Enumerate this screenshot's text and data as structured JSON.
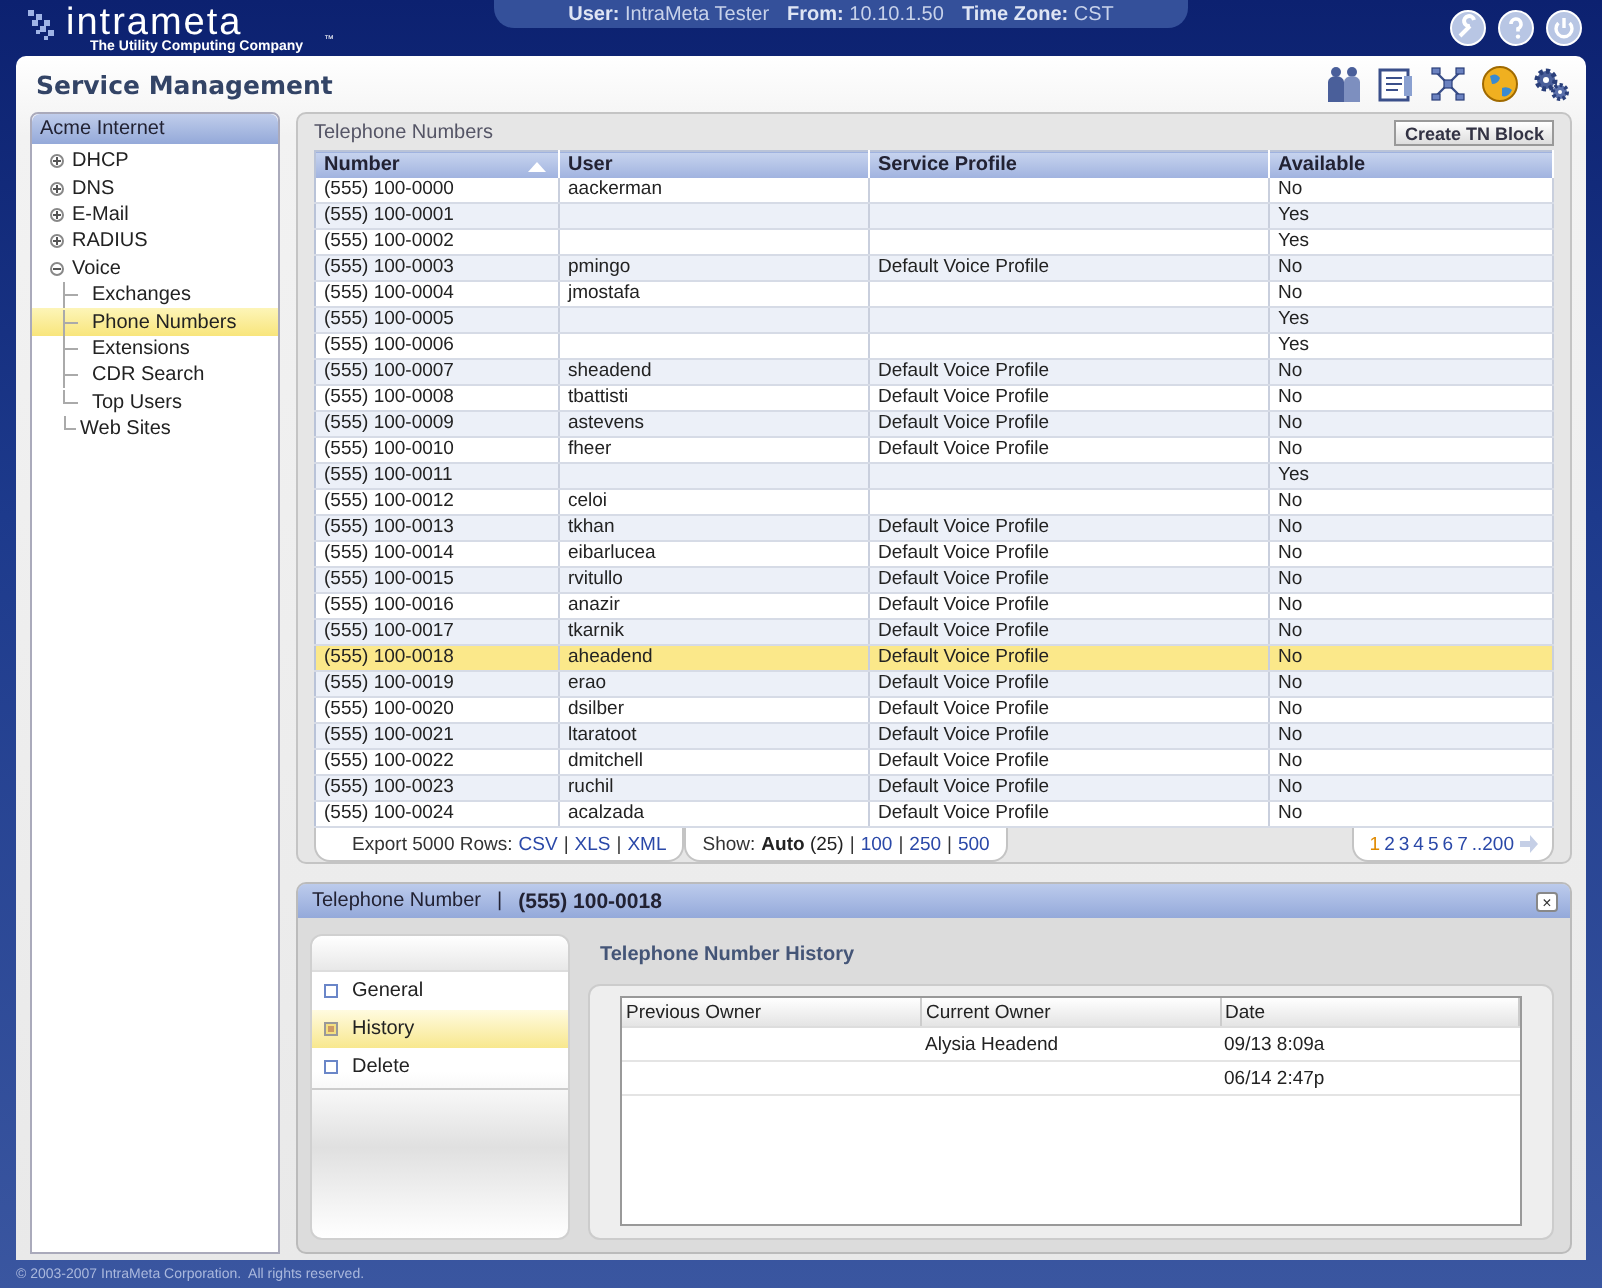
{
  "header": {
    "logo": "intrameta",
    "tagline": "The Utility Computing Company",
    "trademark": "™",
    "user_label": "User:",
    "user": "IntraMeta Tester",
    "from_label": "From:",
    "from": "10.10.1.50",
    "tz_label": "Time Zone:",
    "tz": "CST"
  },
  "page_title": "Service Management",
  "sidebar": {
    "title": "Acme Internet",
    "items": [
      {
        "label": "DHCP",
        "expanded": false,
        "selected": false
      },
      {
        "label": "DNS",
        "expanded": false,
        "selected": false
      },
      {
        "label": "E-Mail",
        "expanded": false,
        "selected": false
      },
      {
        "label": "RADIUS",
        "expanded": false,
        "selected": false
      },
      {
        "label": "Voice",
        "expanded": true,
        "selected": false,
        "children": [
          {
            "label": "Exchanges",
            "selected": false
          },
          {
            "label": "Phone Numbers",
            "selected": true
          },
          {
            "label": "Extensions",
            "selected": false
          },
          {
            "label": "CDR Search",
            "selected": false
          },
          {
            "label": "Top Users",
            "selected": false
          }
        ]
      },
      {
        "label": "Web Sites",
        "selected": false
      }
    ]
  },
  "table_panel": {
    "title": "Telephone Numbers",
    "create_button": "Create TN Block",
    "columns": [
      {
        "label": "Number",
        "sorted": true
      },
      {
        "label": "User",
        "sorted": false
      },
      {
        "label": "Service Profile",
        "sorted": false
      },
      {
        "label": "Available",
        "sorted": false
      }
    ],
    "rows": [
      {
        "number": "(555) 100-0000",
        "user": "aackerman",
        "available": "No",
        "selected": false
      },
      {
        "number": "(555) 100-0001",
        "available": "Yes",
        "selected": false
      },
      {
        "number": "(555) 100-0002",
        "available": "Yes",
        "selected": false
      },
      {
        "number": "(555) 100-0003",
        "user": "pmingo",
        "profile": "Default Voice Profile",
        "available": "No",
        "selected": false
      },
      {
        "number": "(555) 100-0004",
        "user": "jmostafa",
        "available": "No",
        "selected": false
      },
      {
        "number": "(555) 100-0005",
        "available": "Yes",
        "selected": false
      },
      {
        "number": "(555) 100-0006",
        "available": "Yes",
        "selected": false
      },
      {
        "number": "(555) 100-0007",
        "user": "sheadend",
        "profile": "Default Voice Profile",
        "available": "No",
        "selected": false
      },
      {
        "number": "(555) 100-0008",
        "user": "tbattisti",
        "profile": "Default Voice Profile",
        "available": "No",
        "selected": false
      },
      {
        "number": "(555) 100-0009",
        "user": "astevens",
        "profile": "Default Voice Profile",
        "available": "No",
        "selected": false
      },
      {
        "number": "(555) 100-0010",
        "user": "fheer",
        "profile": "Default Voice Profile",
        "available": "No",
        "selected": false
      },
      {
        "number": "(555) 100-0011",
        "available": "Yes",
        "selected": false
      },
      {
        "number": "(555) 100-0012",
        "user": "celoi",
        "available": "No",
        "selected": false
      },
      {
        "number": "(555) 100-0013",
        "user": "tkhan",
        "profile": "Default Voice Profile",
        "available": "No",
        "selected": false
      },
      {
        "number": "(555) 100-0014",
        "user": "eibarlucea",
        "profile": "Default Voice Profile",
        "available": "No",
        "selected": false
      },
      {
        "number": "(555) 100-0015",
        "user": "rvitullo",
        "profile": "Default Voice Profile",
        "available": "No",
        "selected": false
      },
      {
        "number": "(555) 100-0016",
        "user": "anazir",
        "profile": "Default Voice Profile",
        "available": "No",
        "selected": false
      },
      {
        "number": "(555) 100-0017",
        "user": "tkarnik",
        "profile": "Default Voice Profile",
        "available": "No",
        "selected": false
      },
      {
        "number": "(555) 100-0018",
        "user": "aheadend",
        "profile": "Default Voice Profile",
        "available": "No",
        "selected": true
      },
      {
        "number": "(555) 100-0019",
        "user": "erao",
        "profile": "Default Voice Profile",
        "available": "No",
        "selected": false
      },
      {
        "number": "(555) 100-0020",
        "user": "dsilber",
        "profile": "Default Voice Profile",
        "available": "No",
        "selected": false
      },
      {
        "number": "(555) 100-0021",
        "user": "ltaratoot",
        "profile": "Default Voice Profile",
        "available": "No",
        "selected": false
      },
      {
        "number": "(555) 100-0022",
        "user": "dmitchell",
        "profile": "Default Voice Profile",
        "available": "No",
        "selected": false
      },
      {
        "number": "(555) 100-0023",
        "user": "ruchil",
        "profile": "Default Voice Profile",
        "available": "No",
        "selected": false
      },
      {
        "number": "(555) 100-0024",
        "user": "acalzada",
        "profile": "Default Voice Profile",
        "available": "No",
        "selected": false
      }
    ],
    "link_separator": "|",
    "export_label": "Export 5000 Rows:",
    "export_links": [
      "CSV",
      "XLS",
      "XML"
    ],
    "show_label": "Show:",
    "show_options": [
      {
        "label": "Auto",
        "count": "(25)",
        "selected": true
      },
      {
        "label": "100",
        "selected": false
      },
      {
        "label": "250",
        "selected": false
      },
      {
        "label": "500",
        "selected": false
      }
    ],
    "pages": [
      {
        "label": "1",
        "selected": true
      },
      {
        "label": "2",
        "selected": false
      },
      {
        "label": "3",
        "selected": false
      },
      {
        "label": "4",
        "selected": false
      },
      {
        "label": "5",
        "selected": false
      },
      {
        "label": "6",
        "selected": false
      },
      {
        "label": "7",
        "selected": false
      },
      {
        "label": "..200",
        "selected": false
      }
    ]
  },
  "detail": {
    "label": "Telephone Number",
    "separator": "|",
    "value": "(555) 100-0018",
    "close_glyph": "×",
    "menu": [
      {
        "label": "General",
        "selected": false
      },
      {
        "label": "History",
        "selected": true
      },
      {
        "label": "Delete",
        "selected": false
      }
    ],
    "history_title": "Telephone Number History",
    "history_columns": [
      "Previous Owner",
      "Current Owner",
      "Date"
    ],
    "history_rows": [
      {
        "current_owner": "Alysia Headend",
        "date": "09/13 8:09a"
      },
      {
        "date": "06/14 2:47p"
      }
    ]
  },
  "footer": "© 2003-2007 IntraMeta Corporation.  All rights reserved."
}
